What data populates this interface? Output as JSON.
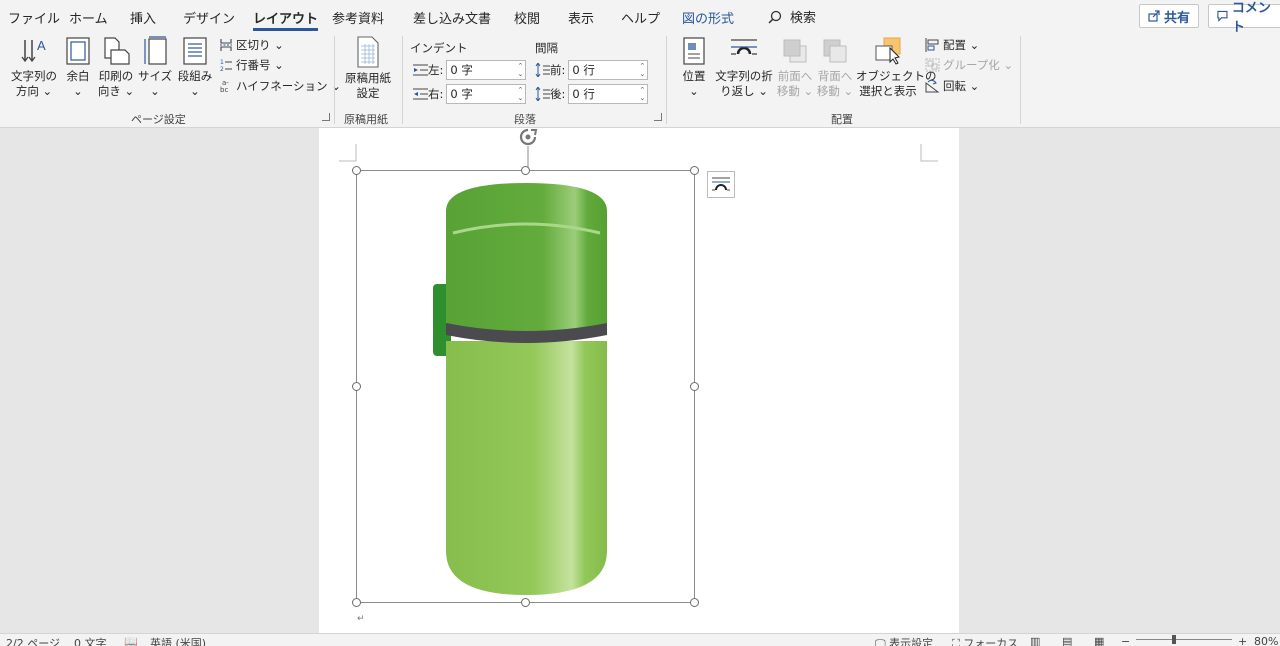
{
  "tabs": [
    {
      "label": "ファイル"
    },
    {
      "label": "ホーム"
    },
    {
      "label": "挿入"
    },
    {
      "label": "デザイン"
    },
    {
      "label": "レイアウト",
      "active": true
    },
    {
      "label": "参考資料"
    },
    {
      "label": "差し込み文書"
    },
    {
      "label": "校閲"
    },
    {
      "label": "表示"
    },
    {
      "label": "ヘルプ"
    },
    {
      "label": "図の形式",
      "contextual": true
    }
  ],
  "search": {
    "label": "検索"
  },
  "share_label": "共有",
  "comment_label": "コメント",
  "ribbon": {
    "page_setup": {
      "label": "ページ設定",
      "text_direction": [
        "文字列の",
        "方向 ⌄"
      ],
      "margins": [
        "余白",
        "⌄"
      ],
      "orientation": [
        "印刷の",
        "向き ⌄"
      ],
      "size": [
        "サイズ",
        "⌄"
      ],
      "columns": [
        "段組み",
        "⌄"
      ],
      "breaks": "区切り ⌄",
      "line_numbers": "行番号 ⌄",
      "hyphenation": "ハイフネーション ⌄"
    },
    "genko": {
      "label": "原稿用紙",
      "button": [
        "原稿用紙",
        "設定"
      ]
    },
    "paragraph": {
      "label": "段落",
      "indent_title": "インデント",
      "spacing_title": "間隔",
      "indent_left_label": "左:",
      "indent_left_value": "0 字",
      "indent_right_label": "右:",
      "indent_right_value": "0 字",
      "spacing_before_label": "前:",
      "spacing_before_value": "0 行",
      "spacing_after_label": "後:",
      "spacing_after_value": "0 行"
    },
    "arrange": {
      "label": "配置",
      "position": [
        "位置",
        "⌄"
      ],
      "wrap_text": [
        "文字列の折",
        "り返し ⌄"
      ],
      "bring_forward": [
        "前面へ",
        "移動 ⌄"
      ],
      "send_backward": [
        "背面へ",
        "移動 ⌄"
      ],
      "selection_pane": [
        "オブジェクトの",
        "選択と表示"
      ],
      "align": "配置 ⌄",
      "group": "グループ化 ⌄",
      "rotate": "回転 ⌄"
    }
  },
  "status": {
    "page": "2/2 ページ",
    "words": "0 文字",
    "language": "英語 (米国)",
    "display_settings": "表示設定",
    "focus": "フォーカス",
    "zoom": "80%"
  },
  "colors": {
    "accent": "#2b579a",
    "thermos_cap": "#5fa83a",
    "thermos_body": "#8fc553",
    "thermos_band": "#4a4a4f",
    "thermos_tab": "#2f8f2f"
  }
}
